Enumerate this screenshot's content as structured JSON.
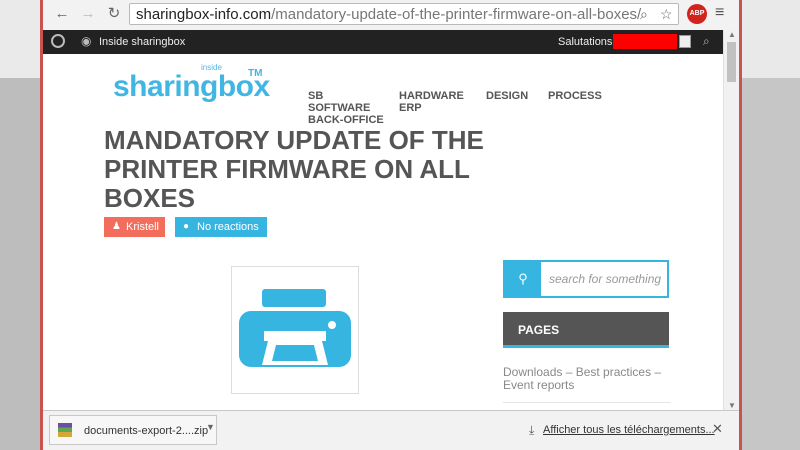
{
  "browser": {
    "url_domain": "sharingbox-info.com",
    "url_path": "/mandatory-update-of-the-printer-firmware-on-all-boxes/",
    "back_icon": "←",
    "forward_icon": "→",
    "reload_icon": "↻",
    "zoom_icon": "⌕",
    "star_icon": "☆",
    "abp_label": "ABP",
    "menu_icon": "≡"
  },
  "adminbar": {
    "site_name": "Inside sharingbox",
    "greeting": "Salutations,",
    "search_icon": "⌕"
  },
  "logo": {
    "small": "inside",
    "main": "sharingbox",
    "tm": "TM"
  },
  "nav": {
    "items": [
      "SB SOFTWARE BACK-OFFICE",
      "HARDWARE ERP",
      "DESIGN",
      "PROCESS"
    ]
  },
  "article": {
    "title": "MANDATORY UPDATE OF THE PRINTER FIRMWARE ON ALL BOXES",
    "author": "Kristell",
    "comments": "No reactions"
  },
  "sidebar": {
    "search_placeholder": "search for something",
    "pages_title": "PAGES",
    "pages_link": "Downloads – Best practices – Event reports"
  },
  "downloads": {
    "file_name": "documents-export-2....zip",
    "show_all": "Afficher tous les téléchargements...",
    "close_icon": "✕"
  },
  "colors": {
    "brand_blue": "#36b5e1",
    "author_tag": "#f26d5b",
    "adminbar": "#222222",
    "redaction": "#ff0000"
  }
}
